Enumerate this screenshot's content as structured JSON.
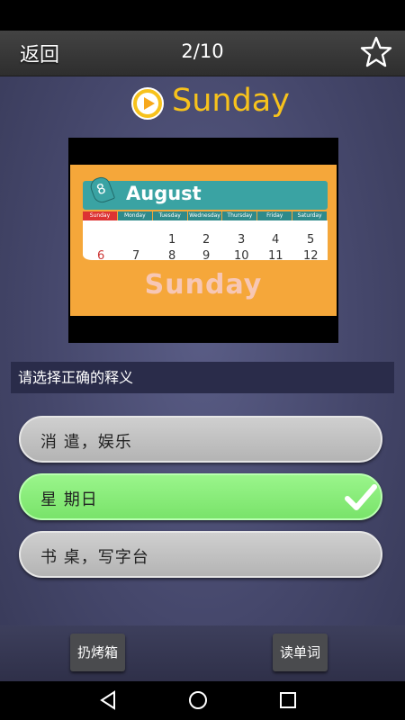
{
  "topbar": {
    "back_label": "返回",
    "progress": "2/10",
    "favorite_icon": "star-icon"
  },
  "word": {
    "text": "Sunday",
    "play_icon": "play-icon",
    "color": "#f7c21c"
  },
  "media": {
    "month_number": "8",
    "month": "August",
    "weekdays": [
      "Sunday",
      "Monday",
      "Tuesday",
      "Wednesday",
      "Thursday",
      "Friday",
      "Saturday"
    ],
    "row1": [
      "1",
      "2",
      "3",
      "4",
      "5"
    ],
    "row2": [
      "6",
      "7",
      "8",
      "9",
      "10",
      "11",
      "12"
    ],
    "caption": "Sunday"
  },
  "prompt": "请选择正确的释义",
  "options": [
    {
      "label": "消 遣，娱乐",
      "correct": false
    },
    {
      "label": "星 期日",
      "correct": true
    },
    {
      "label": "书 桌，写字台",
      "correct": false
    }
  ],
  "bottom": {
    "left_button": "扔烤箱",
    "right_button": "读单词"
  },
  "colors": {
    "correct_bg": "#8cef7c",
    "option_bg": "#c4c4c4",
    "accent": "#f7c21c"
  }
}
